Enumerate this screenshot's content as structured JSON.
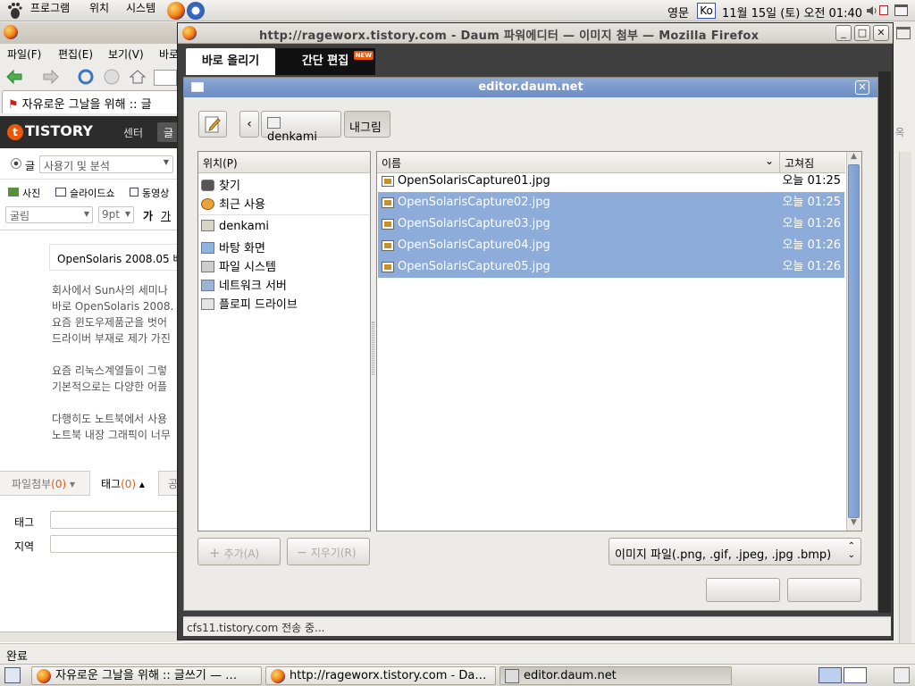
{
  "top_panel": {
    "menus": [
      "프로그램",
      "위치",
      "시스템"
    ],
    "lang": "영문",
    "input_method": "Ko",
    "datetime": "11월 15일 (토) 오전 01:40"
  },
  "bg_window": {
    "menus": [
      "파일(F)",
      "편집(E)",
      "보기(V)",
      "바로"
    ],
    "tab_title": "자유로운 그날을 위해 :: 글",
    "tistory": {
      "logo": "TISTORY",
      "menu": [
        "센터",
        "글"
      ],
      "category_placeholder": "사용기 및 분석",
      "tools": [
        "사진",
        "슬라이드쇼",
        "동영상"
      ],
      "font": "굴림",
      "size": "9pt",
      "bold": "가",
      "italic": "가",
      "post_title": "OpenSolaris 2008.05 배",
      "body": [
        "회사에서 Sun사의 세미나",
        "바로 OpenSolaris 2008.",
        "요즘 윈도우제품군을 벗어",
        "드라이버 부재로 제가 가진",
        "",
        "요즘 리눅스계열들이 그렇",
        "기본적으로는 다양한 어플",
        "",
        "다행히도 노트북에서 사용",
        "노트북 내장 그래픽이 너무"
      ],
      "tab_attach": "파일첨부",
      "attach_count": "(0)",
      "tab_tag": "태그",
      "tag_count": "(0)",
      "tab_more": "공",
      "tag_label": "태그",
      "region_label": "지역"
    },
    "status": "완료",
    "right_clip": "옥"
  },
  "dialog_window": {
    "title": "http://rageworx.tistory.com - Daum 파워에디터 — 이미지 첨부 — Mozilla Firefox",
    "tab_upload": "바로 올리기",
    "tab_edit": "간단 편집",
    "new_badge": "NEW",
    "status": "cfs11.tistory.com 전송 중..."
  },
  "file_chooser": {
    "title": "editor.daum.net",
    "path_buttons": [
      "denkami",
      "내그림"
    ],
    "places_header": "위치(P)",
    "places": [
      {
        "label": "찾기",
        "icon": "binoculars-icon"
      },
      {
        "label": "최근 사용",
        "icon": "recent-icon"
      },
      {
        "label": "denkami",
        "icon": "home-folder-icon"
      },
      {
        "label": "바탕 화면",
        "icon": "desktop-icon"
      },
      {
        "label": "파일 시스템",
        "icon": "drive-icon"
      },
      {
        "label": "네트워크 서버",
        "icon": "network-icon"
      },
      {
        "label": "플로피 드라이브",
        "icon": "floppy-icon"
      }
    ],
    "col_name": "이름",
    "col_modified": "고쳐짐",
    "files": [
      {
        "name": "OpenSolarisCapture01.jpg",
        "modified": "오늘 01:25",
        "selected": false
      },
      {
        "name": "OpenSolarisCapture02.jpg",
        "modified": "오늘 01:25",
        "selected": true
      },
      {
        "name": "OpenSolarisCapture03.jpg",
        "modified": "오늘 01:26",
        "selected": true
      },
      {
        "name": "OpenSolarisCapture04.jpg",
        "modified": "오늘 01:26",
        "selected": true
      },
      {
        "name": "OpenSolarisCapture05.jpg",
        "modified": "오늘 01:26",
        "selected": true
      }
    ],
    "add_btn": "추가(A)",
    "remove_btn": "지우기(R)",
    "filter": "이미지 파일(.png, .gif, .jpeg, .jpg .bmp)",
    "selection_color": "#8eacd9"
  },
  "taskbar": {
    "tasks": [
      "자유로운 그날을 위해 :: 글쓰기 — …",
      "http://rageworx.tistory.com - Da…",
      "editor.daum.net"
    ]
  }
}
